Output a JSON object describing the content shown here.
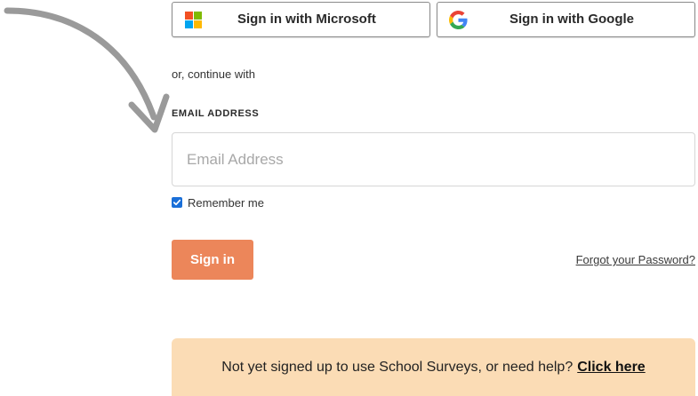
{
  "sso": {
    "microsoft_label": "Sign in with Microsoft",
    "google_label": "Sign in with Google"
  },
  "form": {
    "divider_text": "or, continue with",
    "email_label": "EMAIL ADDRESS",
    "email_placeholder": "Email Address",
    "email_value": "",
    "remember_label": "Remember me",
    "remember_checked": true,
    "signin_label": "Sign in",
    "forgot_label": "Forgot your Password?"
  },
  "help": {
    "text": "Not yet signed up to use School Surveys, or need help?",
    "link_label": "Click here"
  },
  "colors": {
    "signin_button": "#ec865a",
    "help_banner": "#fbdcb5",
    "checkbox": "#1a6fd8",
    "ms_red": "#f25022",
    "ms_green": "#7fba00",
    "ms_blue": "#00a4ef",
    "ms_yellow": "#ffb900"
  },
  "icons": {
    "microsoft": "microsoft-logo-icon",
    "google": "google-logo-icon",
    "arrow": "curved-arrow-icon",
    "check": "checkmark-icon"
  }
}
